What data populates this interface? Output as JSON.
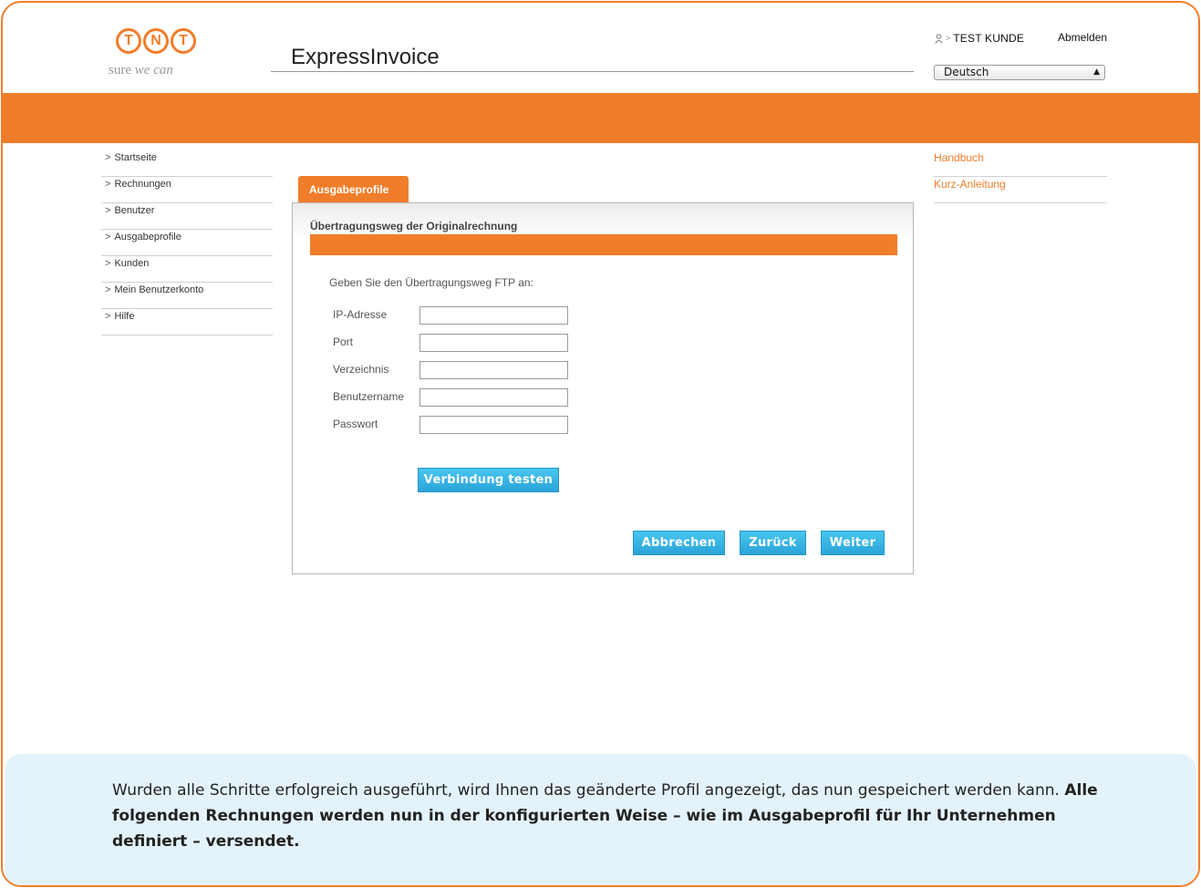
{
  "header": {
    "logo_letters": [
      "T",
      "N",
      "T"
    ],
    "logo_tagline_plain": "sure",
    "logo_tagline_script": "we can",
    "app_title": "ExpressInvoice",
    "user_name": "TEST KUNDE",
    "logout_label": "Abmelden",
    "language_selected": "Deutsch"
  },
  "left_nav": {
    "items": [
      {
        "label": "Startseite"
      },
      {
        "label": "Rechnungen"
      },
      {
        "label": "Benutzer"
      },
      {
        "label": "Ausgabeprofile"
      },
      {
        "label": "Kunden"
      },
      {
        "label": "Mein Benutzerkonto"
      },
      {
        "label": "Hilfe"
      }
    ]
  },
  "right_links": {
    "items": [
      {
        "label": "Handbuch"
      },
      {
        "label": "Kurz-Anleitung"
      }
    ]
  },
  "main": {
    "tab_label": "Ausgabeprofile",
    "section_title": "Übertragungsweg der Originalrechnung",
    "instruction": "Geben Sie den Übertragungsweg FTP an:",
    "fields": [
      {
        "label": "IP-Adresse",
        "value": ""
      },
      {
        "label": "Port",
        "value": ""
      },
      {
        "label": "Verzeichnis",
        "value": ""
      },
      {
        "label": "Benutzername",
        "value": ""
      },
      {
        "label": "Passwort",
        "value": ""
      }
    ],
    "test_connection_label": "Verbindung testen",
    "cancel_label": "Abbrechen",
    "back_label": "Zurück",
    "next_label": "Weiter"
  },
  "info": {
    "text_plain": "Wurden alle Schritte erfolgreich ausgeführt, wird Ihnen das geänderte Profil angezeigt, das nun gespeichert werden kann.",
    "text_bold": "Alle folgenden Rechnungen werden nun in der konfigurierten Weise – wie im Ausgabeprofil für Ihr Unternehmen definiert – versendet."
  },
  "colors": {
    "brand_orange": "#f07d2a",
    "button_blue": "#2ba3d9",
    "info_background": "#e4f3fb"
  },
  "icons": {
    "user": "user-icon",
    "nav_chevron": "chevron-right-icon",
    "select_arrow": "updown-arrow-icon"
  }
}
